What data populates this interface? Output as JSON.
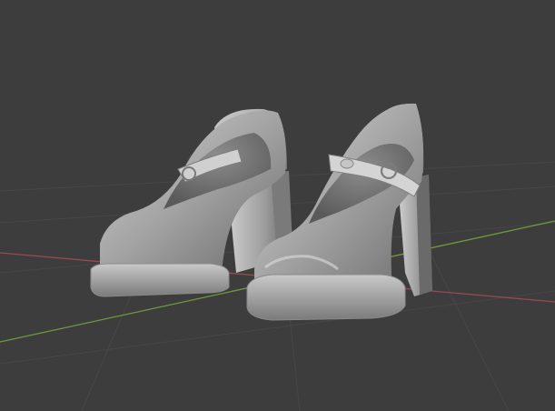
{
  "viewport": {
    "background_color": "#3d3d3d",
    "grid_line_color": "#474747",
    "x_axis_color": "#9a4a50",
    "y_axis_color": "#6f9a3e",
    "model_color": "#9a9a9a",
    "model_highlight_color": "#d9d9d9",
    "model_shadow_color": "#5f5f5f",
    "object": "pair-of-platform-mary-jane-shoes"
  }
}
